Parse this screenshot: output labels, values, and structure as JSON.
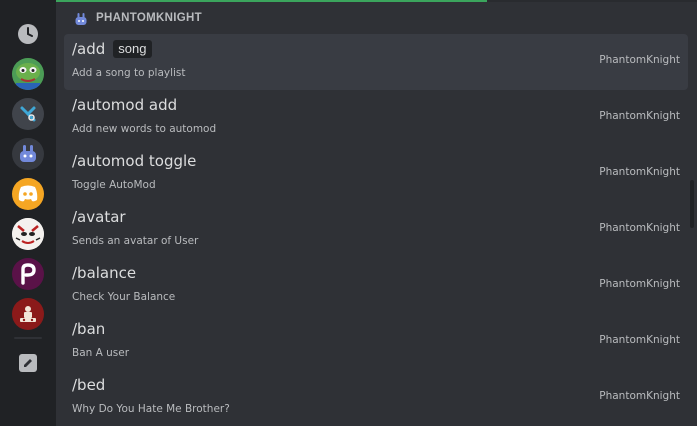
{
  "header": {
    "title": "PHANTOMKNIGHT"
  },
  "commands": [
    {
      "name": "/add",
      "param": "song",
      "description": "Add a song to playlist",
      "owner": "PhantomKnight"
    },
    {
      "name": "/automod add",
      "param": "",
      "description": "Add new words to automod",
      "owner": "PhantomKnight"
    },
    {
      "name": "/automod toggle",
      "param": "",
      "description": "Toggle AutoMod",
      "owner": "PhantomKnight"
    },
    {
      "name": "/avatar",
      "param": "",
      "description": "Sends an avatar of User",
      "owner": "PhantomKnight"
    },
    {
      "name": "/balance",
      "param": "",
      "description": "Check Your Balance",
      "owner": "PhantomKnight"
    },
    {
      "name": "/ban",
      "param": "",
      "description": "Ban A user",
      "owner": "PhantomKnight"
    },
    {
      "name": "/bed",
      "param": "",
      "description": "Why Do You Hate Me Brother?",
      "owner": "PhantomKnight"
    }
  ],
  "colors": {
    "accent": "#3ba55d",
    "panel": "#2f3136",
    "rail": "#202225",
    "selected": "#393c43"
  }
}
